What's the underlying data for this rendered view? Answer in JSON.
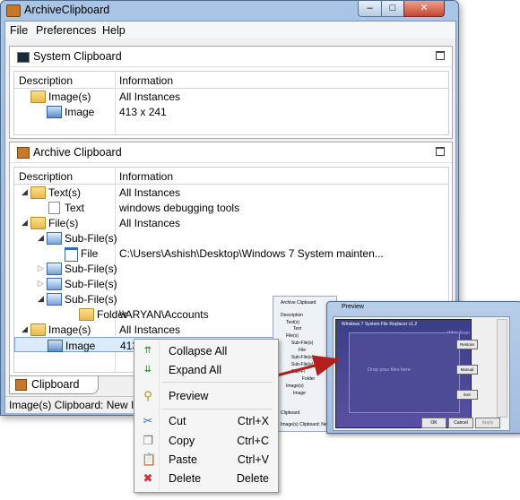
{
  "window": {
    "title": "ArchiveClipboard",
    "controls": {
      "minimize": "–",
      "maximize": "□",
      "close": "✕"
    }
  },
  "menu": [
    "File",
    "Preferences",
    "Help"
  ],
  "system_clipboard": {
    "title": "System Clipboard",
    "columns": [
      "Description",
      "Information"
    ],
    "rows": [
      {
        "description": "Image(s)",
        "information": "All Instances"
      },
      {
        "description": "Image",
        "information": "413 x 241"
      }
    ]
  },
  "archive_clipboard": {
    "title": "Archive Clipboard",
    "columns": [
      "Description",
      "Information"
    ],
    "rows": [
      {
        "description": "Text(s)",
        "information": "All Instances"
      },
      {
        "description": "Text",
        "information": "windows debugging tools"
      },
      {
        "description": "File(s)",
        "information": "All Instances"
      },
      {
        "description": "Sub-File(s)",
        "information": ""
      },
      {
        "description": "File",
        "information": "C:\\Users\\Ashish\\Desktop\\Windows 7 System mainten..."
      },
      {
        "description": "Sub-File(s)",
        "information": ""
      },
      {
        "description": "Sub-File(s)",
        "information": ""
      },
      {
        "description": "Sub-File(s)",
        "information": ""
      },
      {
        "description": "Folder",
        "information": "\\\\ARYAN\\Accounts"
      },
      {
        "description": "Image(s)",
        "information": "All Instances"
      },
      {
        "description": "Image",
        "information": "413 x 241"
      }
    ]
  },
  "tab": {
    "label": "Clipboard"
  },
  "status": {
    "text": "Image(s) Clipboard: New Image"
  },
  "context_menu": {
    "items": [
      {
        "label": "Collapse All",
        "shortcut": "",
        "icon": "collapse-all-icon"
      },
      {
        "label": "Expand All",
        "shortcut": "",
        "icon": "expand-all-icon"
      },
      {
        "label": "Preview",
        "shortcut": "",
        "icon": "magnifier-icon"
      },
      {
        "label": "Cut",
        "shortcut": "Ctrl+X",
        "icon": "scissors-icon"
      },
      {
        "label": "Copy",
        "shortcut": "Ctrl+C",
        "icon": "copy-icon"
      },
      {
        "label": "Paste",
        "shortcut": "Ctrl+V",
        "icon": "paste-icon"
      },
      {
        "label": "Delete",
        "shortcut": "Delete",
        "icon": "delete-x-icon"
      }
    ]
  },
  "preview_popup": {
    "title": "Preview",
    "inner_title": "Windows 7 System File Replacer v1.2",
    "drop_text": "Drop your files here",
    "side_label": "Whip Team",
    "buttons": [
      "Restore",
      "Manual",
      "Exit"
    ],
    "dialog_buttons": [
      "OK",
      "Cancel",
      "Apply"
    ],
    "background_window": {
      "title": "Archive Clipboard",
      "items": [
        "Description",
        "Text(s)",
        "Text",
        "File(s)",
        "Sub-File(s)",
        "File",
        "Sub-File(s)",
        "Sub-File(s)",
        "Sub-Fi",
        "Folder",
        "Image(s)",
        "Image",
        "Clipboard",
        "Image(s) Clipboard: New"
      ]
    }
  },
  "colors": {
    "selection": "#dcebfc",
    "arrow": "#b3201c",
    "close_button": "#c8452d"
  }
}
